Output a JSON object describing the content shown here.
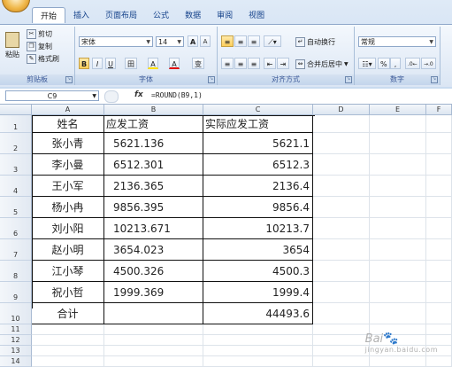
{
  "ribbon": {
    "tabs": [
      "开始",
      "插入",
      "页面布局",
      "公式",
      "数据",
      "审阅",
      "视图"
    ],
    "clipboard": {
      "paste": "粘贴",
      "cut": "剪切",
      "copy": "复制",
      "format_painter": "格式刷",
      "label": "剪贴板"
    },
    "font": {
      "name": "宋体",
      "size": "14",
      "grow": "A",
      "shrink": "A",
      "bold": "B",
      "italic": "I",
      "underline": "U",
      "border": "田",
      "fill": "A",
      "color": "A",
      "phonetic": "变",
      "label": "字体"
    },
    "alignment": {
      "wrap": "自动换行",
      "merge": "合并后居中",
      "label": "对齐方式"
    },
    "number": {
      "format": "常规",
      "percent": "%",
      "comma": ",",
      "label": "数字"
    }
  },
  "formula_bar": {
    "cell_ref": "C9",
    "fx": "fx",
    "formula": "=ROUND(B9,1)"
  },
  "grid": {
    "columns": [
      "A",
      "B",
      "C",
      "D",
      "E",
      "F"
    ],
    "row_numbers": [
      "1",
      "2",
      "3",
      "4",
      "5",
      "6",
      "7",
      "8",
      "9",
      "10",
      "11",
      "12",
      "13",
      "14"
    ],
    "header": [
      "姓名",
      "应发工资",
      "实际应发工资"
    ],
    "rows": [
      [
        "张小青",
        "5621.136",
        "5621.1"
      ],
      [
        "李小曼",
        "6512.301",
        "6512.3"
      ],
      [
        "王小军",
        "2136.365",
        "2136.4"
      ],
      [
        "杨小冉",
        "9856.395",
        "9856.4"
      ],
      [
        "刘小阳",
        "10213.671",
        "10213.7"
      ],
      [
        "赵小明",
        "3654.023",
        "3654"
      ],
      [
        "江小琴",
        "4500.326",
        "4500.3"
      ],
      [
        "祝小哲",
        "1999.369",
        "1999.4"
      ]
    ],
    "total": [
      "合计",
      "",
      "44493.6"
    ]
  },
  "watermark": {
    "text": "Bai",
    "sub": "jingyan.baidu.com"
  }
}
